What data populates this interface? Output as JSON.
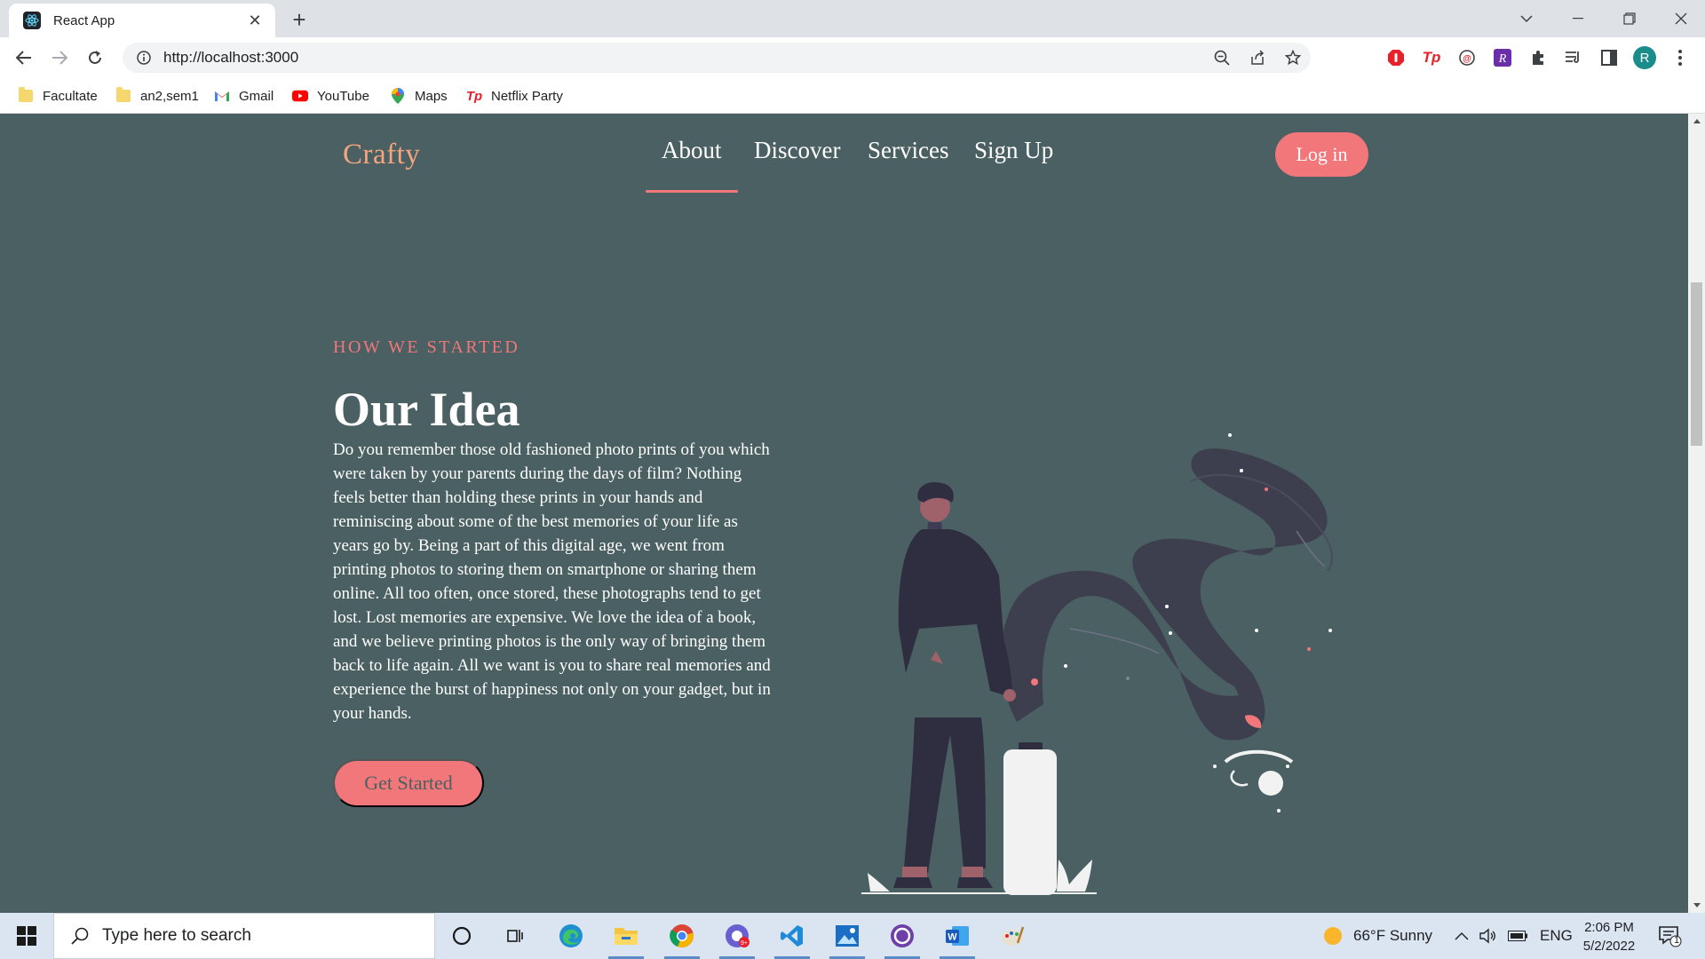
{
  "browser": {
    "tab_title": "React App",
    "url": "http://localhost:3000",
    "profile_initial": "R",
    "bookmarks": [
      "Facultate",
      "an2,sem1",
      "Gmail",
      "YouTube",
      "Maps",
      "Netflix Party"
    ]
  },
  "page": {
    "logo": "Crafty",
    "nav": [
      "About",
      "Discover",
      "Services",
      "Sign Up"
    ],
    "active_nav": "About",
    "login_label": "Log in",
    "eyebrow": "HOW WE STARTED",
    "heading": "Our Idea",
    "body": "Do you remember those old fashioned photo prints of you which were taken by your parents during the days of film? Nothing feels better than holding these prints in your hands and reminiscing about some of the best memories of your life as years go by. Being a part of this digital age, we went from printing photos to storing them on smartphone or sharing them online. All too often, once stored, these photographs tend to get lost. Lost memories are expensive. We love the idea of a book, and we believe printing photos is the only way of bringing them back to life again. All we want is you to share real memories and experience the burst of happiness not only on your gadget, but in your hands.",
    "cta_label": "Get Started",
    "colors": {
      "background": "#4b6062",
      "accent": "#f2777a",
      "logo": "#f4a57e"
    }
  },
  "taskbar": {
    "search_placeholder": "Type here to search",
    "weather": "66°F  Sunny",
    "language": "ENG",
    "time": "2:06 PM",
    "date": "5/2/2022",
    "notification_count": "1"
  }
}
